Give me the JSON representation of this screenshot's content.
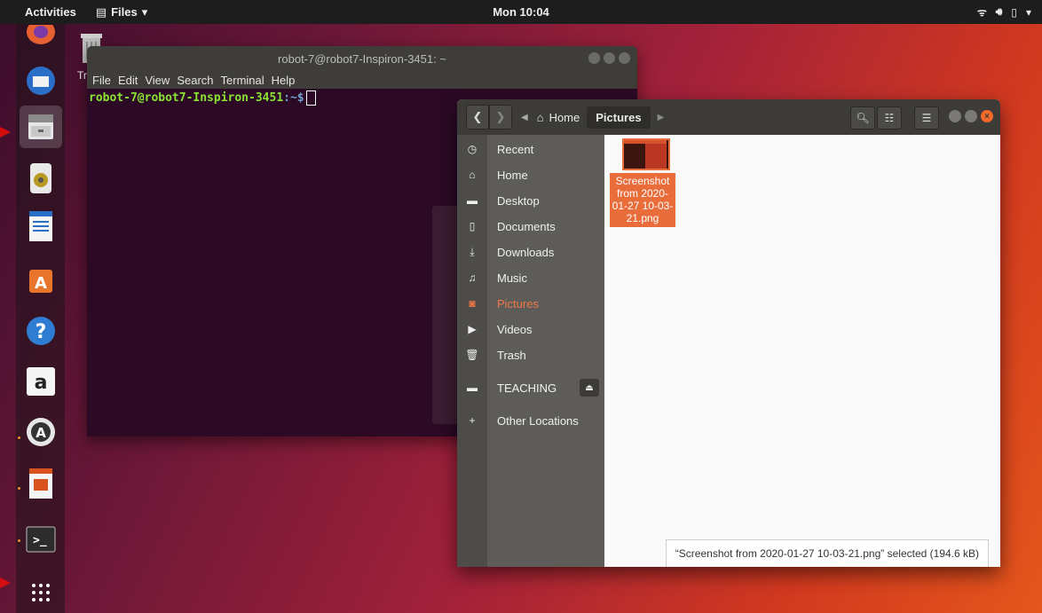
{
  "topbar": {
    "activities": "Activities",
    "app_menu": "Files",
    "clock": "Mon 10:04"
  },
  "desktop": {
    "trash_label": "Tr"
  },
  "terminal": {
    "title": "robot-7@robot7-Inspiron-3451: ~",
    "menu": [
      "File",
      "Edit",
      "View",
      "Search",
      "Terminal",
      "Help"
    ],
    "prompt_user": "robot-7@robot7-Inspiron-3451",
    "prompt_path": ":~$"
  },
  "files": {
    "breadcrumbs": {
      "home": "Home",
      "current": "Pictures"
    },
    "sidebar": [
      {
        "label": "Recent",
        "icon": "clock-icon"
      },
      {
        "label": "Home",
        "icon": "home-icon"
      },
      {
        "label": "Desktop",
        "icon": "folder-icon"
      },
      {
        "label": "Documents",
        "icon": "document-icon"
      },
      {
        "label": "Downloads",
        "icon": "download-icon"
      },
      {
        "label": "Music",
        "icon": "music-icon"
      },
      {
        "label": "Pictures",
        "icon": "camera-icon"
      },
      {
        "label": "Videos",
        "icon": "video-icon"
      },
      {
        "label": "Trash",
        "icon": "trash-icon"
      },
      {
        "label": "TEACHING",
        "icon": "drive-icon"
      },
      {
        "label": "Other Locations",
        "icon": "plus-icon"
      }
    ],
    "selected_item": "Pictures",
    "file": {
      "name_line1": "Screenshot",
      "name_line2": "from 2020-",
      "name_line3": "01-27 10-03-",
      "name_line4": "21.png"
    },
    "status": "“Screenshot from 2020-01-27 10-03-21.png” selected  (194.6 kB)"
  },
  "colors": {
    "accent": "#e86d3b",
    "topbar": "#1d1d1d",
    "terminal_bg": "#2c0a25"
  }
}
